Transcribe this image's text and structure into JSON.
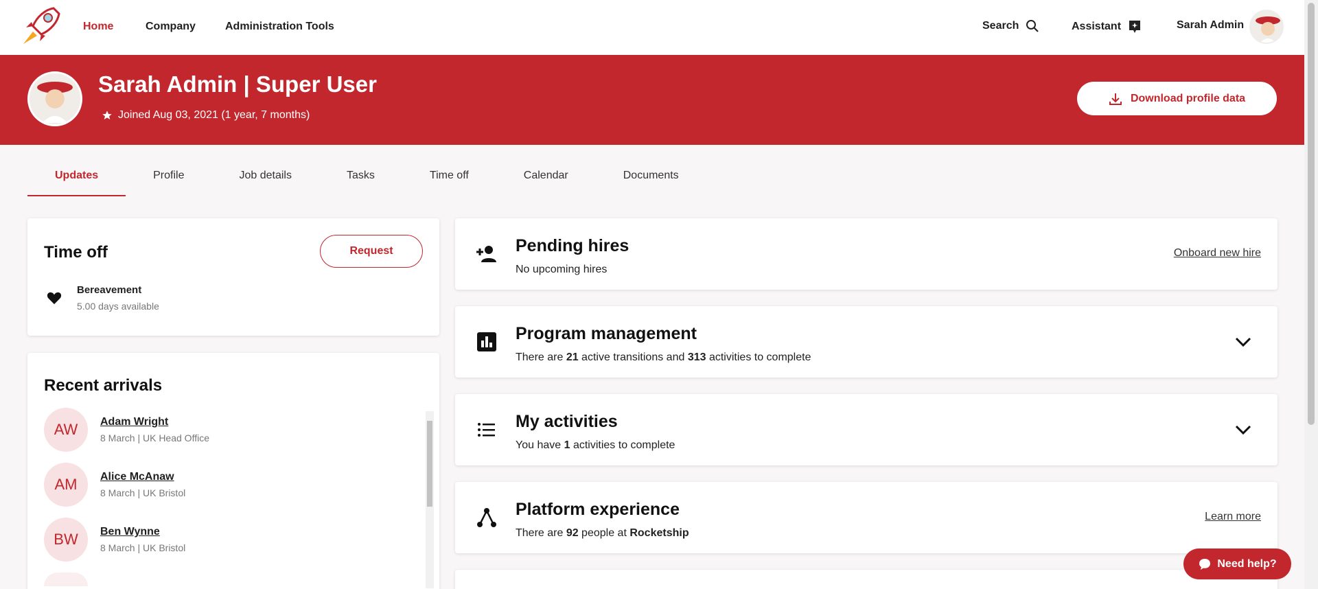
{
  "nav": {
    "links": [
      "Home",
      "Company",
      "Administration Tools"
    ],
    "search_label": "Search",
    "assistant_label": "Assistant",
    "user_label": "Sarah Admin"
  },
  "banner": {
    "title": "Sarah Admin | Super User",
    "joined": "Joined Aug 03, 2021 (1 year, 7 months)",
    "download_label": "Download profile data"
  },
  "tabs": [
    "Updates",
    "Profile",
    "Job details",
    "Tasks",
    "Time off",
    "Calendar",
    "Documents"
  ],
  "time_off": {
    "title": "Time off",
    "request_label": "Request",
    "item_name": "Bereavement",
    "item_available": "5.00 days available"
  },
  "recent_arrivals": {
    "title": "Recent arrivals",
    "people": [
      {
        "initials": "AW",
        "name": "Adam Wright",
        "meta": "8 March | UK Head Office"
      },
      {
        "initials": "AM",
        "name": "Alice McAnaw",
        "meta": "8 March | UK Bristol"
      },
      {
        "initials": "BW",
        "name": "Ben Wynne",
        "meta": "8 March | UK Bristol"
      }
    ]
  },
  "panels": {
    "pending": {
      "title": "Pending hires",
      "sub": "No upcoming hires",
      "link": "Onboard new hire"
    },
    "program": {
      "title": "Program management",
      "sub_a": "There are ",
      "n1": "21",
      "sub_b": " active transitions and ",
      "n2": "313",
      "sub_c": " activities to complete"
    },
    "activities": {
      "title": "My activities",
      "sub_a": "You have ",
      "n1": "1",
      "sub_b": " activities to complete"
    },
    "platform": {
      "title": "Platform experience",
      "sub_a": "There are ",
      "n1": "92",
      "sub_b": " people at ",
      "company": "Rocketship",
      "link": "Learn more"
    }
  },
  "help": {
    "label": "Need help?"
  },
  "colors": {
    "brand": "#c1272d"
  }
}
